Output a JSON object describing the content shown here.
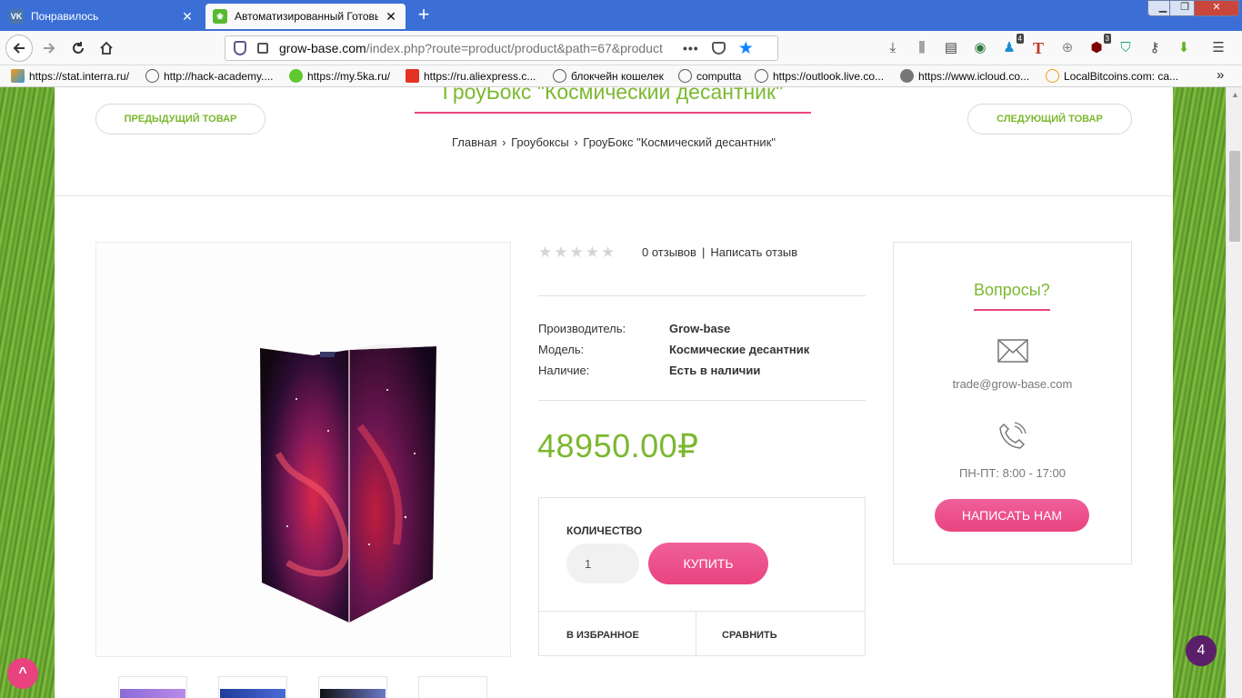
{
  "browser": {
    "tabs": [
      {
        "title": "Понравилось",
        "favicon": "vk-icon",
        "close": "✕"
      },
      {
        "title": "Автоматизированный Готовый",
        "favicon": "grow-base-icon",
        "close": "✕"
      }
    ],
    "new_tab": "+",
    "window_controls": {
      "minimize": "▁",
      "maximize": "❐",
      "close": "✕"
    },
    "url": {
      "host": "grow-base.com",
      "path": "/index.php?route=product/product&path=67&product"
    },
    "page_actions": "•••",
    "bookmarks": [
      "https://stat.interra.ru/",
      "http://hack-academy....",
      "https://my.5ka.ru/",
      "https://ru.aliexpress.c...",
      "блокчейн кошелек",
      "computta",
      "https://outlook.live.co...",
      "https://www.icloud.co...",
      "LocalBitcoins.com: ca..."
    ],
    "bookmarks_more": "»",
    "toolbar_badges": {
      "ext1": "4",
      "ext2": "3"
    }
  },
  "page": {
    "prev_label": "ПРЕДЫДУЩИЙ ТОВАР",
    "next_label": "СЛЕДУЮЩИЙ ТОВАР",
    "title": "ГроуБокс \"Космический десантник\"",
    "breadcrumb": [
      {
        "text": "Главная"
      },
      {
        "sep": "›"
      },
      {
        "text": "Гроубоксы"
      },
      {
        "sep": "›"
      },
      {
        "text": "ГроуБокс \"Космический десантник\""
      }
    ],
    "rating": {
      "stars": 0,
      "max": 5
    },
    "reviews_text": "0 отзывов",
    "reviews_sep": "|",
    "write_review": "Написать отзыв",
    "specs": [
      {
        "label": "Производитель:",
        "value": "Grow-base"
      },
      {
        "label": "Модель:",
        "value": "Космические десантник"
      },
      {
        "label": "Наличие:",
        "value": "Есть в наличии"
      }
    ],
    "price": "48950.00₽",
    "qty_label": "КОЛИЧЕСТВО",
    "qty_value": "1",
    "buy_label": "КУПИТЬ",
    "favorite_label": "В ИЗБРАННОЕ",
    "compare_label": "СРАВНИТЬ"
  },
  "questions": {
    "title": "Вопросы?",
    "email": "trade@grow-base.com",
    "hours": "ПН-ПТ: 8:00 - 17:00",
    "button": "НАПИСАТЬ НАМ"
  },
  "widgets": {
    "scroll_top": "^",
    "badge_count": "4"
  },
  "colors": {
    "accent_green": "#7cb82f",
    "accent_pink": "#e8437f",
    "tab_bar": "#3b6fd6"
  }
}
